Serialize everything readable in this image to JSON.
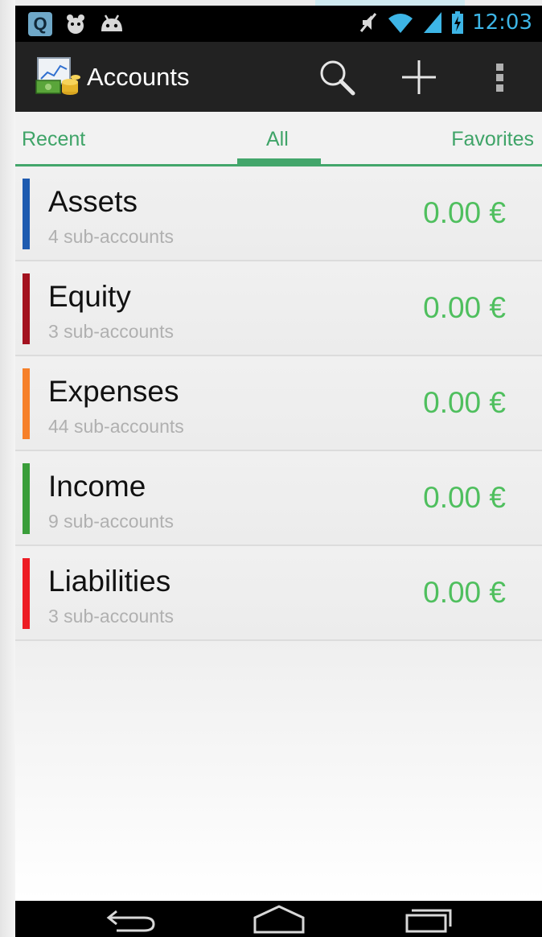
{
  "status_bar": {
    "left_icons": [
      "quickoffice-icon",
      "notification-app-icon",
      "android-icon"
    ],
    "right_icons": [
      "mute-icon",
      "wifi-icon",
      "signal-icon",
      "battery-charging-icon"
    ],
    "time": "12:03"
  },
  "action_bar": {
    "title": "Accounts",
    "actions": [
      "search-icon",
      "add-icon",
      "overflow-menu-icon"
    ]
  },
  "tabs": {
    "items": [
      {
        "label": "Recent"
      },
      {
        "label": "All",
        "selected": true
      },
      {
        "label": "Favorites"
      }
    ]
  },
  "accounts": [
    {
      "name": "Assets",
      "sub": "4 sub-accounts",
      "amount": "0.00 €",
      "color": "#1e5bb0"
    },
    {
      "name": "Equity",
      "sub": "3 sub-accounts",
      "amount": "0.00 €",
      "color": "#a3121f"
    },
    {
      "name": "Expenses",
      "sub": "44 sub-accounts",
      "amount": "0.00 €",
      "color": "#f6802a"
    },
    {
      "name": "Income",
      "sub": "9 sub-accounts",
      "amount": "0.00 €",
      "color": "#3a9e3a"
    },
    {
      "name": "Liabilities",
      "sub": "3 sub-accounts",
      "amount": "0.00 €",
      "color": "#ed1c24"
    }
  ],
  "nav_bar": {
    "buttons": [
      "back-icon",
      "home-icon",
      "recent-apps-icon"
    ]
  },
  "colors": {
    "accent_green": "#43a66b",
    "amount_green": "#4fbf5e",
    "time_blue": "#3db5e6"
  }
}
